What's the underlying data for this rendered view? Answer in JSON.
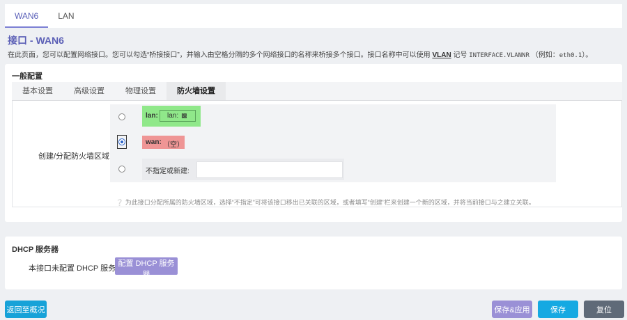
{
  "tabs": [
    {
      "label": "WAN6",
      "active": true
    },
    {
      "label": "LAN",
      "active": false
    }
  ],
  "page": {
    "title": "接口 - WAN6",
    "description_pre": "在此页面，您可以配置网络接口。您可以勾选“桥接接口”，并输入由空格分隔的多个网络接口的名称来桥接多个接口。接口名称中可以使用",
    "description_vlan": "VLAN",
    "description_mid": "记号",
    "description_code": "INTERFACE.VLANNR",
    "description_example_pre": "（例如：",
    "description_example_code": "eth0.1",
    "description_example_post": "）。"
  },
  "general": {
    "section_title": "一般配置",
    "subtabs": [
      {
        "label": "基本设置",
        "active": false
      },
      {
        "label": "高级设置",
        "active": false
      },
      {
        "label": "物理设置",
        "active": false
      },
      {
        "label": "防火墙设置",
        "active": true
      }
    ],
    "zone_field_label": "创建/分配防火墙区域",
    "zones": {
      "lan": {
        "name": "lan:",
        "member": "lan:",
        "icon": "network-port-icon",
        "color": "#90e88a"
      },
      "wan": {
        "name": "wan:",
        "value": "（空）",
        "color": "#ef9595",
        "selected": true
      },
      "new_label": "不指定或新建:",
      "new_value": ""
    },
    "hint": "为此接口分配所属的防火墙区域，选择“不指定”可将该接口移出已关联的区域，或者填写“创建”栏来创建一个新的区域，并将当前接口与之建立关联。"
  },
  "dhcp": {
    "section_title": "DHCP 服务器",
    "status_label": "本接口未配置 DHCP 服务器",
    "configure_button": "配置 DHCP 服务器"
  },
  "footer": {
    "back": "返回至概况",
    "save_apply": "保存&应用",
    "save": "保存",
    "reset": "复位"
  },
  "colors": {
    "accent": "#5b5fb6",
    "save_apply_bg": "#9a90d6",
    "save_bg": "#15a9e2",
    "reset_bg": "#5f6a78",
    "back_bg": "#17a2d8"
  }
}
